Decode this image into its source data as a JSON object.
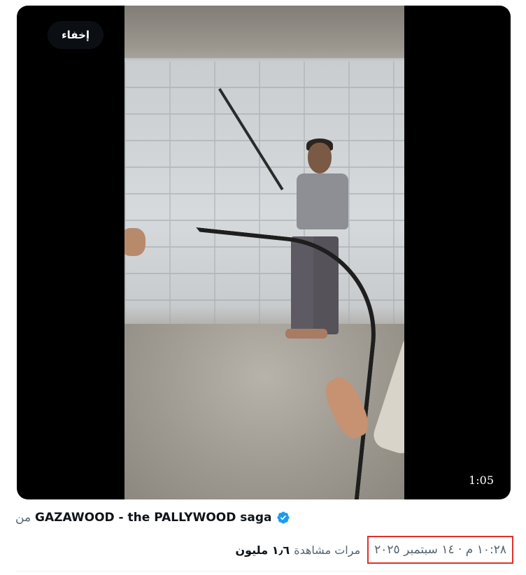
{
  "media": {
    "hide_label": "إخفاء",
    "duration": "1:05"
  },
  "source": {
    "prefix": "من",
    "name": "GAZAWOOD - the PALLYWOOD saga",
    "verified_icon": "verified-badge-icon",
    "verified_color": "#1d9bf0"
  },
  "meta": {
    "timestamp": "١٠:٢٨ م · ١٤ سبتمبر ٢٠٢٥",
    "views_count": "١٫٦ مليون",
    "views_label": "مرات مشاهدة"
  },
  "colors": {
    "highlight_box": "#e0302b",
    "secondary_text": "#536471"
  }
}
